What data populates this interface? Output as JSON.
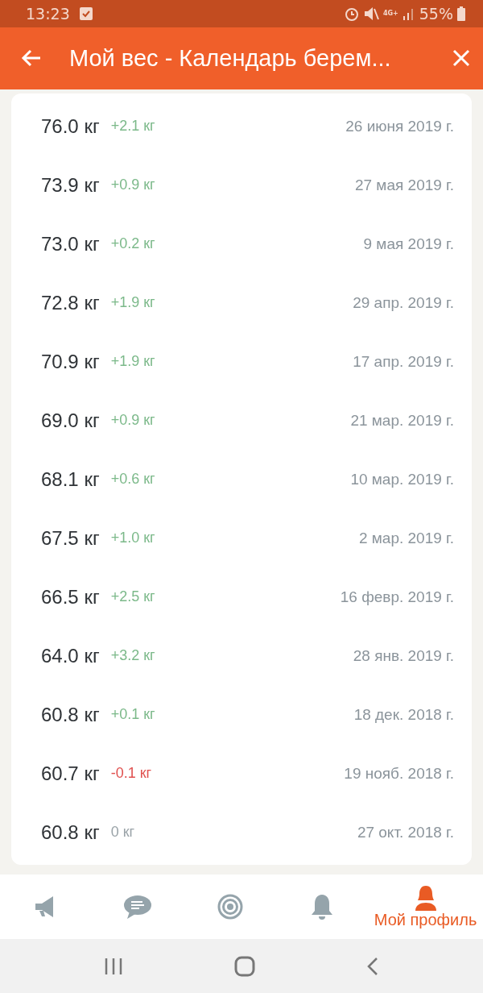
{
  "status_bar": {
    "time": "13:23",
    "network": "4G+",
    "battery": "55%"
  },
  "header": {
    "title": "Мой вес - Календарь берем..."
  },
  "entries": [
    {
      "weight": "76.0 кг",
      "change": "+2.1 кг",
      "color": "#7cb98a",
      "date": "26 июня 2019 г."
    },
    {
      "weight": "73.9 кг",
      "change": "+0.9 кг",
      "color": "#7cb98a",
      "date": "27 мая 2019 г."
    },
    {
      "weight": "73.0 кг",
      "change": "+0.2 кг",
      "color": "#7cb98a",
      "date": "9 мая 2019 г."
    },
    {
      "weight": "72.8 кг",
      "change": "+1.9 кг",
      "color": "#7cb98a",
      "date": "29 апр. 2019 г."
    },
    {
      "weight": "70.9 кг",
      "change": "+1.9 кг",
      "color": "#7cb98a",
      "date": "17 апр. 2019 г."
    },
    {
      "weight": "69.0 кг",
      "change": "+0.9 кг",
      "color": "#7cb98a",
      "date": "21 мар. 2019 г."
    },
    {
      "weight": "68.1 кг",
      "change": "+0.6 кг",
      "color": "#7cb98a",
      "date": "10 мар. 2019 г."
    },
    {
      "weight": "67.5 кг",
      "change": "+1.0 кг",
      "color": "#7cb98a",
      "date": "2 мар. 2019 г."
    },
    {
      "weight": "66.5 кг",
      "change": "+2.5 кг",
      "color": "#7cb98a",
      "date": "16 февр. 2019 г."
    },
    {
      "weight": "64.0 кг",
      "change": "+3.2 кг",
      "color": "#7cb98a",
      "date": "28 янв. 2019 г."
    },
    {
      "weight": "60.8 кг",
      "change": "+0.1 кг",
      "color": "#7cb98a",
      "date": "18 дек. 2018 г."
    },
    {
      "weight": "60.7 кг",
      "change": "-0.1 кг",
      "color": "#e0514f",
      "date": "19 нояб. 2018 г."
    },
    {
      "weight": "60.8 кг",
      "change": "0 кг",
      "color": "#9aa3a8",
      "date": "27 окт. 2018 г."
    }
  ],
  "bottom_nav": [
    {
      "kind": "megaphone",
      "selected": false
    },
    {
      "kind": "chat",
      "selected": false
    },
    {
      "kind": "target",
      "selected": false
    },
    {
      "kind": "bell",
      "selected": false
    },
    {
      "kind": "person",
      "selected": true,
      "label": "Мой профиль"
    }
  ]
}
